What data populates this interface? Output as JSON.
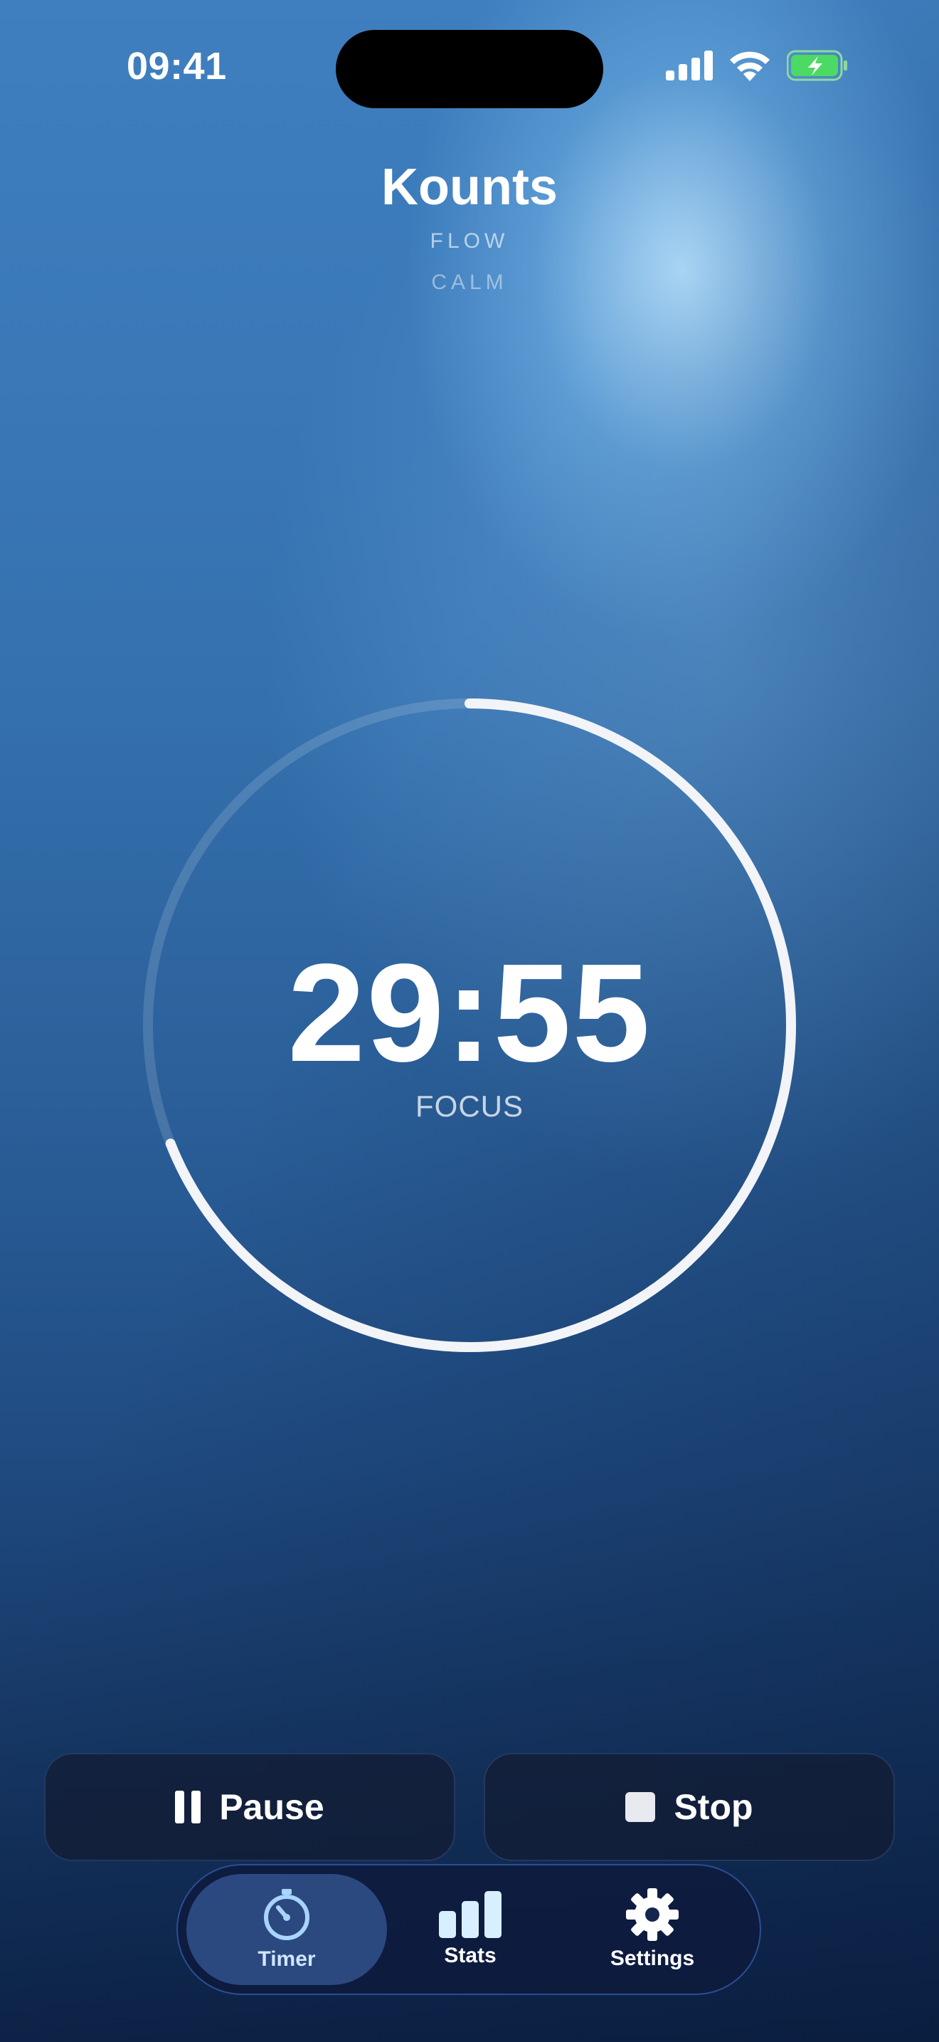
{
  "status_bar": {
    "time": "09:41",
    "icons": [
      "cellular-signal-icon",
      "wifi-icon",
      "battery-charging-icon"
    ],
    "battery_color": "#4cd964"
  },
  "header": {
    "title": "Kounts",
    "subtitle_primary": "FLOW",
    "subtitle_secondary": "CALM"
  },
  "timer": {
    "value": "29:55",
    "mode": "FOCUS",
    "progress_fraction": 0.69
  },
  "controls": {
    "pause_label": "Pause",
    "stop_label": "Stop",
    "pause_icon": "pause-icon",
    "stop_icon": "stop-icon"
  },
  "tabbar": {
    "active": "Timer",
    "items": [
      {
        "label": "Timer",
        "icon": "stopwatch-icon"
      },
      {
        "label": "Stats",
        "icon": "bar-chart-icon"
      },
      {
        "label": "Settings",
        "icon": "gear-icon"
      }
    ]
  },
  "colors": {
    "accent": "#cfe6ff",
    "background_top": "#3f7fbf",
    "background_bottom": "#0d2347"
  }
}
